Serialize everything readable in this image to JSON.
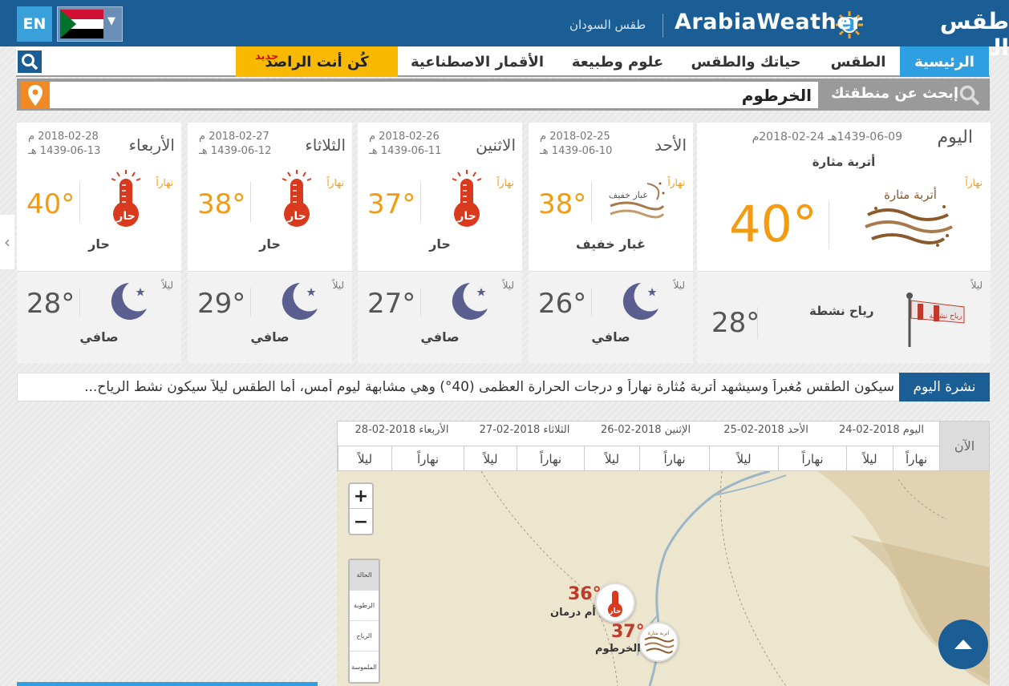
{
  "header": {
    "lang_button": "EN",
    "site_title": "طقس العرب",
    "brand": "ArabiaWeather",
    "country_link": "طقس السودان"
  },
  "nav": {
    "items": [
      {
        "label": "الرئيسية",
        "active": true
      },
      {
        "label": "الطقس"
      },
      {
        "label": "حياتك والطقس"
      },
      {
        "label": "علوم وطبيعة"
      },
      {
        "label": "الأقمار الاصطناعية"
      }
    ],
    "reporter": {
      "label": "كُن أنت الراصد",
      "badge": "جديد"
    }
  },
  "search": {
    "label": "إبحث عن منطقتك",
    "value": "الخرطوم"
  },
  "today": {
    "day": "اليوم",
    "date": "1439-06-09هـ 24-02-2018م",
    "summary": "أتربة مثارة",
    "day_tag": "نهاراً",
    "day_temp": "40°",
    "icon_text": "أتربة مثارة",
    "night_tag": "ليلاً",
    "night_temp": "28°",
    "night_cond": "رياح نشطة",
    "wind_icon_text": "رياح نشطة"
  },
  "forecast": [
    {
      "day": "الأحد",
      "date_g": "2018-02-25 م",
      "date_h": "1439-06-10 هـ",
      "day_tag": "نهاراً",
      "day_temp": "38°",
      "day_cond": "غبار خفيف",
      "icon": "light-dust-icon",
      "icon_text": "غبار خفيف",
      "night_tag": "ليلاً",
      "night_temp": "26°",
      "night_cond": "صافي"
    },
    {
      "day": "الاثنين",
      "date_g": "2018-02-26 م",
      "date_h": "1439-06-11 هـ",
      "day_tag": "نهاراً",
      "day_temp": "37°",
      "day_cond": "حار",
      "icon": "hot-thermometer-icon",
      "icon_text": "حار",
      "night_tag": "ليلاً",
      "night_temp": "27°",
      "night_cond": "صافي"
    },
    {
      "day": "الثلاثاء",
      "date_g": "2018-02-27 م",
      "date_h": "1439-06-12 هـ",
      "day_tag": "نهاراً",
      "day_temp": "38°",
      "day_cond": "حار",
      "icon": "hot-thermometer-icon",
      "icon_text": "حار",
      "night_tag": "ليلاً",
      "night_temp": "29°",
      "night_cond": "صافي"
    },
    {
      "day": "الأربعاء",
      "date_g": "2018-02-28 م",
      "date_h": "1439-06-13 هـ",
      "day_tag": "نهاراً",
      "day_temp": "40°",
      "day_cond": "حار",
      "icon": "hot-thermometer-icon",
      "icon_text": "حار",
      "night_tag": "ليلاً",
      "night_temp": "28°",
      "night_cond": "صافي"
    }
  ],
  "ticker": {
    "label": "نشرة اليوم",
    "text": "سيكون الطقس مُغبراً وسيشهد أتربة مُثارة نهاراً و درجات الحرارة العظمى (40°) وهي مشابهة ليوم أمس، أما الطقس ليلاً سيكون نشط الرياح..."
  },
  "timeline": {
    "now_label": "الآن",
    "dates": [
      "اليوم 2018-02-24",
      "الأحد 2018-02-25",
      "الإثنين 2018-02-26",
      "الثلاثاء 2018-02-27",
      "الأربعاء 2018-02-28"
    ],
    "day_label": "نهاراً",
    "night_label": "ليلاً"
  },
  "map": {
    "zoom_in": "+",
    "zoom_out": "−",
    "layers": [
      "الحالة",
      "الرطوبة",
      "الرياح",
      "الملموسة"
    ],
    "markers": [
      {
        "name": "أم درمان",
        "temp": "36°",
        "icon_text": "حار"
      },
      {
        "name": "الخرطوم",
        "temp": "37°",
        "icon_text": "أتربة مثارة"
      }
    ]
  },
  "colors": {
    "header_blue": "#1b5e96",
    "accent_blue": "#2e9fe0",
    "reporter_yellow": "#f9b900",
    "temp_orange": "#f39c12",
    "hot_red": "#c0392b"
  }
}
